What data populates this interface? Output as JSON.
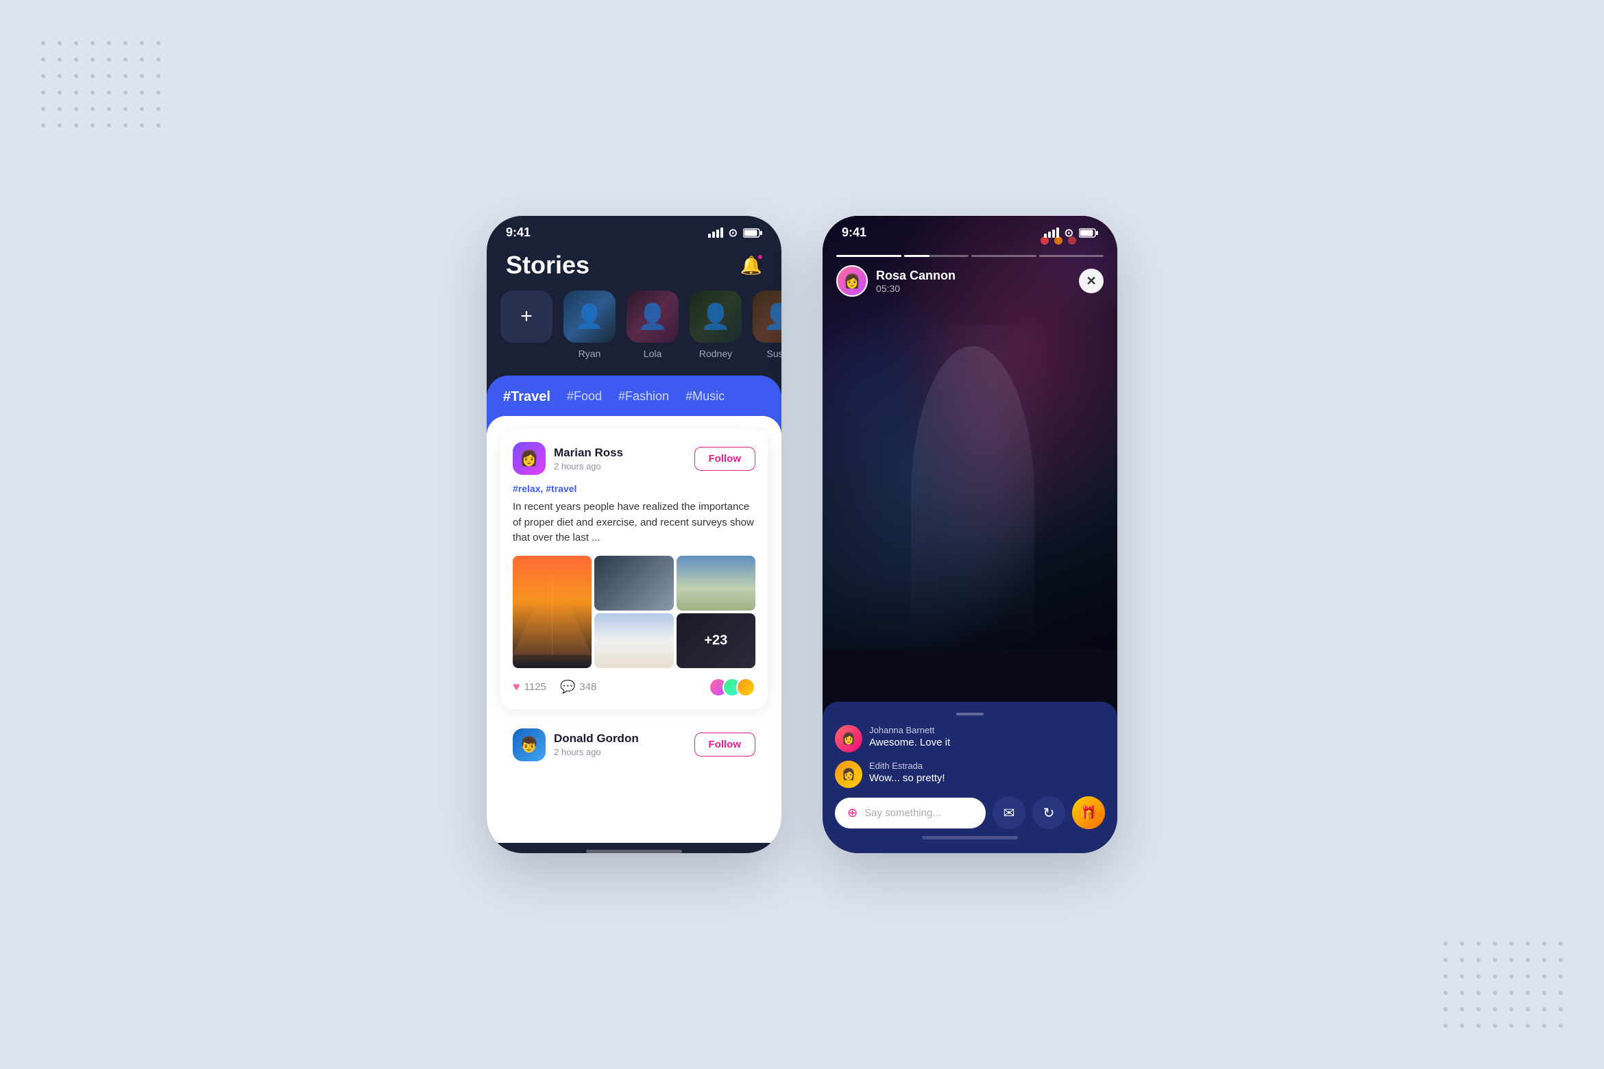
{
  "background": {
    "color": "#dde4f0"
  },
  "phone1": {
    "statusBar": {
      "time": "9:41",
      "signal": "signal-icon",
      "wifi": "wifi-icon",
      "battery": "battery-icon"
    },
    "header": {
      "title": "Stories",
      "bellIcon": "bell-icon"
    },
    "stories": [
      {
        "name": "Ryan",
        "thumb": "ryan-thumb"
      },
      {
        "name": "Lola",
        "thumb": "lola-thumb"
      },
      {
        "name": "Rodney",
        "thumb": "rodney-thumb"
      },
      {
        "name": "Susie",
        "thumb": "susie-thumb"
      }
    ],
    "hashtags": [
      {
        "label": "#Travel",
        "active": true
      },
      {
        "label": "#Food",
        "active": false
      },
      {
        "label": "#Fashion",
        "active": false
      },
      {
        "label": "#Music",
        "active": false
      }
    ],
    "posts": [
      {
        "author": "Marian Ross",
        "time": "2 hours ago",
        "followLabel": "Follow",
        "tags": "#relax, #travel",
        "text": "In recent years people have realized the importance of proper diet and exercise, and recent surveys show that over the last ...",
        "likesCount": "1125",
        "commentsCount": "348",
        "moreCount": "+23"
      },
      {
        "author": "Donald Gordon",
        "time": "2 hours ago",
        "followLabel": "Follow"
      }
    ]
  },
  "phone2": {
    "statusBar": {
      "time": "9:41",
      "signal": "signal-icon",
      "wifi": "wifi-icon",
      "battery": "battery-icon"
    },
    "storyUser": {
      "name": "Rosa Cannon",
      "time": "05:30"
    },
    "progressBars": [
      1,
      0.4,
      0,
      0
    ],
    "comments": [
      {
        "username": "Johanna Barnett",
        "text": "Awesome. Love it"
      },
      {
        "username": "Edith Estrada",
        "text": "Wow... so pretty!"
      }
    ],
    "inputPlaceholder": "Say something...",
    "closeButton": "✕",
    "actions": [
      "message-icon",
      "share-icon",
      "gift-icon"
    ]
  }
}
